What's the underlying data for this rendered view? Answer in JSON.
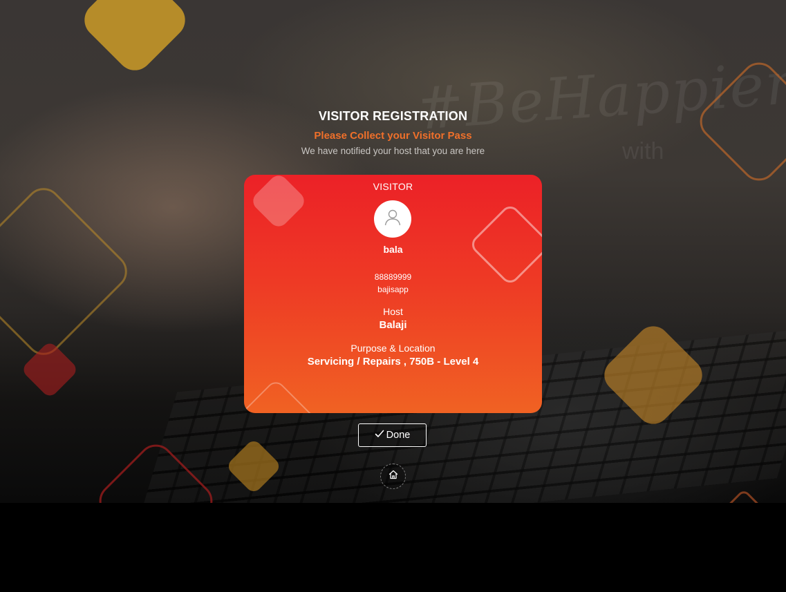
{
  "background": {
    "watermark_text": "#BeHappier",
    "watermark_sub": "with"
  },
  "header": {
    "title": "VISITOR REGISTRATION",
    "subtitle": "Please Collect your Visitor Pass",
    "note": "We have notified your host that you are here"
  },
  "pass": {
    "label": "VISITOR",
    "avatar_icon": "user-icon",
    "name": "bala",
    "phone": "88889999",
    "company": "bajisapp",
    "host_label": "Host",
    "host_name": "Balaji",
    "purpose_label": "Purpose & Location",
    "purpose_value": "Servicing / Repairs , 750B - Level 4"
  },
  "actions": {
    "done_label": "Done",
    "done_icon": "checkmark-icon",
    "home_icon": "home-icon"
  },
  "colors": {
    "accent": "#f0702a",
    "card_top": "#ec2127",
    "card_bottom": "#f06223"
  }
}
